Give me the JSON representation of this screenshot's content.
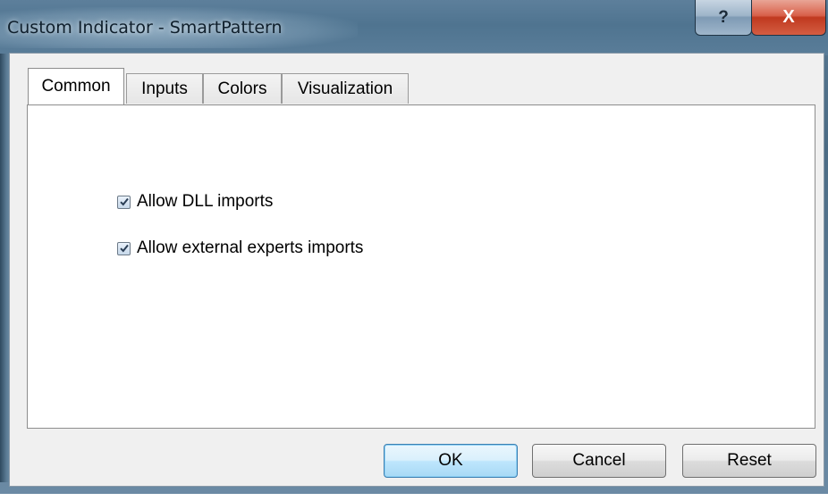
{
  "window": {
    "title": "Custom Indicator - SmartPattern",
    "help_glyph": "?",
    "close_glyph": "X"
  },
  "tabs": [
    {
      "label": "Common",
      "active": true
    },
    {
      "label": "Inputs",
      "active": false
    },
    {
      "label": "Colors",
      "active": false
    },
    {
      "label": "Visualization",
      "active": false
    }
  ],
  "options": [
    {
      "label": "Allow DLL imports",
      "checked": true
    },
    {
      "label": "Allow external experts imports",
      "checked": true
    }
  ],
  "buttons": {
    "ok": "OK",
    "cancel": "Cancel",
    "reset": "Reset"
  },
  "colors": {
    "title_bar": "#4f7490",
    "close_button": "#c0391f",
    "default_button_border": "#3c7fb1"
  }
}
